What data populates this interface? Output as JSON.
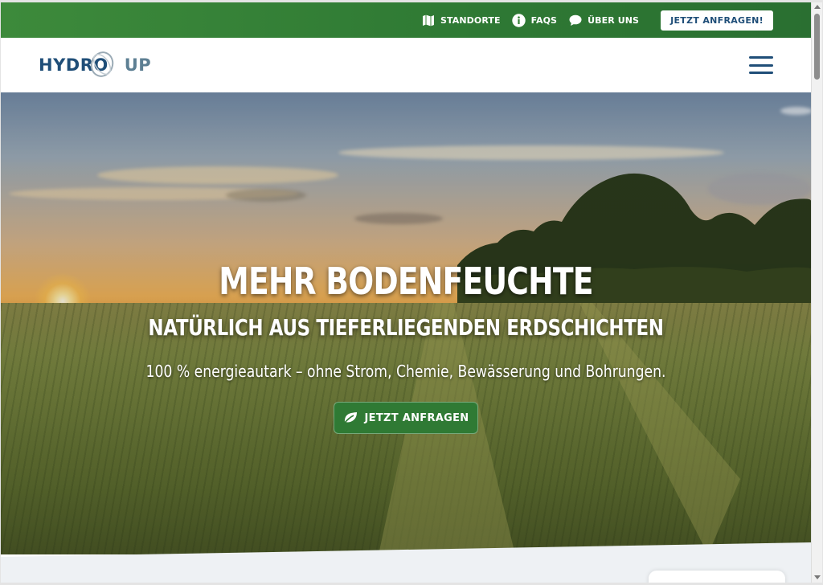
{
  "topbar": {
    "links": [
      {
        "label": "STANDORTE",
        "icon": "map-icon"
      },
      {
        "label": "FAQS",
        "icon": "info-icon"
      },
      {
        "label": "ÜBER UNS",
        "icon": "chat-bubble-icon"
      }
    ],
    "cta_label": "JETZT ANFRAGEN!"
  },
  "header": {
    "logo_part1": "HYDRO",
    "logo_part2": "UP",
    "menu_icon": "hamburger-menu-icon"
  },
  "hero": {
    "title": "MEHR BODENFEUCHTE",
    "subtitle": "NATÜRLICH AUS TIEFERLIEGENDEN ERDSCHICHTEN",
    "text": "100 % energieautark – ohne Strom, Chemie, Bewässerung und Bohrungen.",
    "cta_label": "JETZT ANFRAGEN",
    "cta_icon": "leaf-icon"
  },
  "colors": {
    "brand_green": "#2f7a34",
    "brand_blue": "#1f4e78"
  }
}
